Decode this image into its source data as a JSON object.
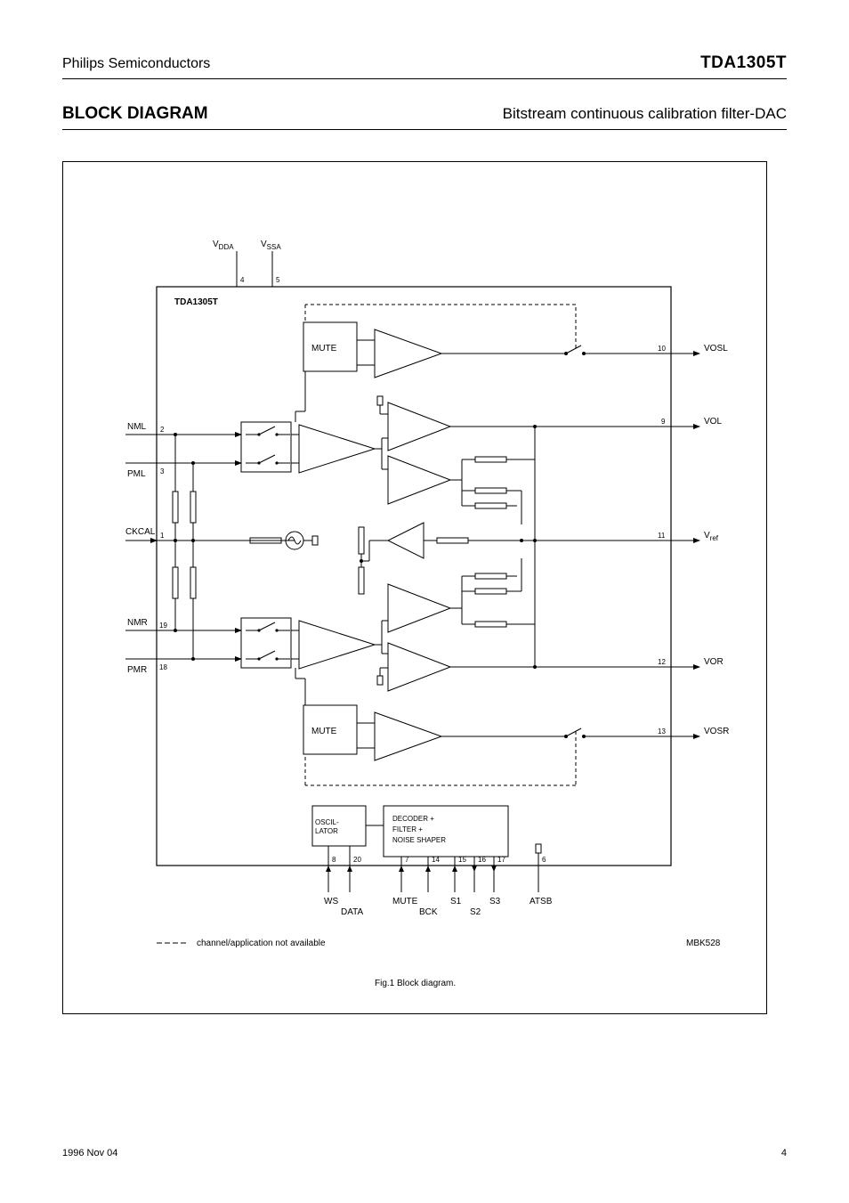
{
  "header": {
    "brand": "Philips Semiconductors",
    "part": "TDA1305T"
  },
  "section": {
    "title": "BLOCK DIAGRAM",
    "subtitle": "Bitstream continuous calibration filter-DAC"
  },
  "diagram": {
    "top_pins": {
      "vdda": "V_DDA",
      "vssa": "V_SSA",
      "vdda_pin": "4",
      "vssa_pin": "5"
    },
    "mute_L": "MUTE",
    "mute_R": "MUTE",
    "pin_nml": {
      "label": "NML",
      "pin": "2"
    },
    "pin_pml": {
      "label": "PML",
      "pin": "3"
    },
    "pin_nmr": {
      "label": "NMR",
      "pin": "19"
    },
    "pin_pmr": {
      "label": "PMR",
      "pin": "18"
    },
    "pin_ckcal": {
      "label": "CKCAL",
      "pin": "1"
    },
    "vosl": {
      "label": "VOSL",
      "pin": "10"
    },
    "vol": {
      "label": "VOL",
      "pin": "9"
    },
    "vref": {
      "label": "V_ref",
      "pin": "11"
    },
    "vor": {
      "label": "VOR",
      "pin": "12"
    },
    "vosr": {
      "label": "VOSR",
      "pin": "13"
    },
    "atsb": {
      "label": "ATSB",
      "pin": "6"
    },
    "ws": {
      "label": "WS",
      "pin": "8"
    },
    "data": {
      "label": "DATA",
      "pin": "20"
    },
    "mute_pin": {
      "label": "MUTE",
      "pin": "7"
    },
    "osc_block": "OSCILLATOR",
    "decoder_block": "DECODER + FILTER + NOISE SHAPER",
    "bck": {
      "label": "BCK",
      "pin": "14"
    },
    "s1": {
      "label": "S1",
      "pin": "15"
    },
    "s2": {
      "label": "S2",
      "pin": "16"
    },
    "s3": {
      "label": "S3",
      "pin": "17"
    },
    "bottom_note": "channel/application not available",
    "fig_id": "MBK528",
    "caption": "Fig.1  Block diagram.",
    "chip": "TDA1305T"
  },
  "footer": {
    "date": "1996 Nov 04",
    "page": "4"
  }
}
